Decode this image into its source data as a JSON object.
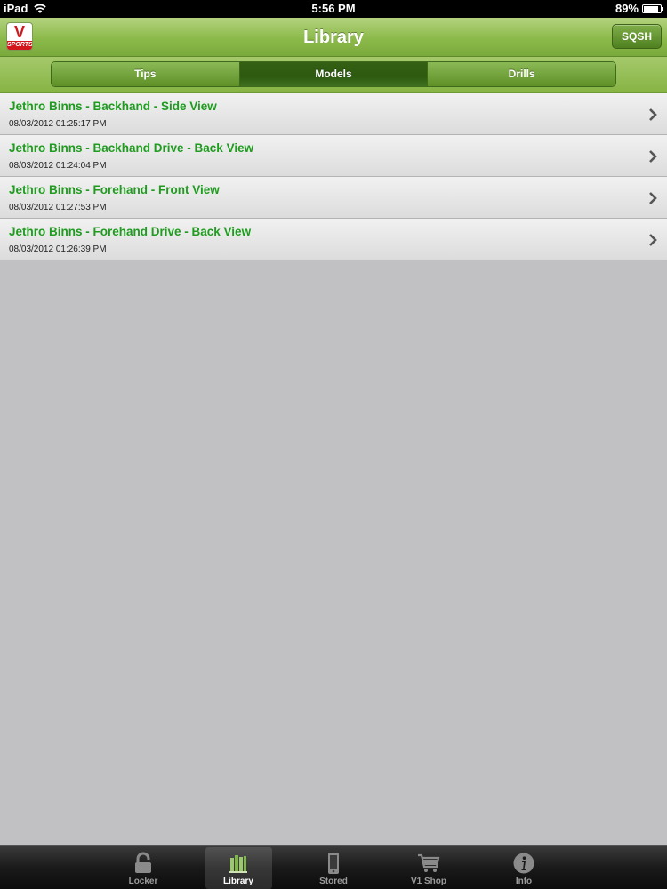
{
  "status_bar": {
    "device": "iPad",
    "time": "5:56 PM",
    "battery": "89%",
    "battery_level": 0.89
  },
  "nav_bar": {
    "logo_text": "V",
    "logo_band_text": "SPORTS",
    "title": "Library",
    "right_button": "SQSH"
  },
  "segments": [
    {
      "label": "Tips",
      "selected": false
    },
    {
      "label": "Models",
      "selected": true
    },
    {
      "label": "Drills",
      "selected": false
    }
  ],
  "list_items": [
    {
      "title": "Jethro Binns - Backhand - Side View",
      "date": "08/03/2012 01:25:17 PM"
    },
    {
      "title": "Jethro Binns - Backhand Drive - Back View",
      "date": "08/03/2012 01:24:04 PM"
    },
    {
      "title": "Jethro Binns - Forehand - Front View",
      "date": "08/03/2012 01:27:53 PM"
    },
    {
      "title": "Jethro Binns - Forehand Drive - Back View",
      "date": "08/03/2012 01:26:39 PM"
    }
  ],
  "tabs": [
    {
      "label": "Locker",
      "icon": "lock-icon",
      "selected": false
    },
    {
      "label": "Library",
      "icon": "books-icon",
      "selected": true
    },
    {
      "label": "Stored",
      "icon": "phone-icon",
      "selected": false
    },
    {
      "label": "V1 Shop",
      "icon": "cart-icon",
      "selected": false
    },
    {
      "label": "Info",
      "icon": "info-icon",
      "selected": false
    }
  ],
  "colors": {
    "accent_green": "#1f9b1f",
    "nav_green": "#8cba4a",
    "selected_segment": "#2d5a10"
  }
}
